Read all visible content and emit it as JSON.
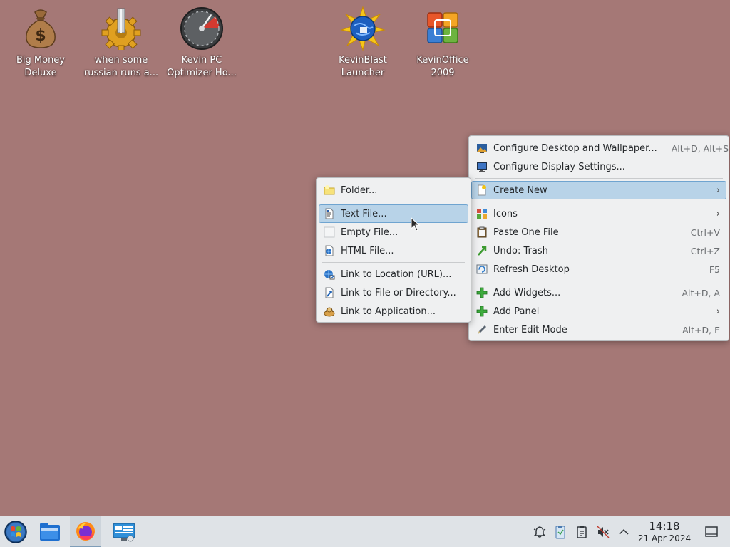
{
  "desktop": {
    "background_color": "#a57876",
    "icons": [
      {
        "line1": "Big Money",
        "line2": "Deluxe",
        "icon": "money-bag-icon"
      },
      {
        "line1": "when some",
        "line2": "russian runs a...",
        "icon": "gear-icon"
      },
      {
        "line1": "Kevin PC",
        "line2": "Optimizer Ho...",
        "icon": "gauge-icon"
      },
      {
        "line1": "KevinBlast",
        "line2": "Launcher",
        "icon": "globe-star-icon"
      },
      {
        "line1": "KevinOffice",
        "line2": "2009",
        "icon": "office-logo-icon"
      }
    ]
  },
  "context_menu": {
    "items": {
      "configure_desktop": {
        "label": "Configure Desktop and Wallpaper...",
        "shortcut": "Alt+D, Alt+S"
      },
      "configure_display": {
        "label": "Configure Display Settings..."
      },
      "create_new": {
        "label": "Create New",
        "highlighted": true
      },
      "icons": {
        "label": "Icons"
      },
      "paste": {
        "label": "Paste One File",
        "shortcut": "Ctrl+V"
      },
      "undo": {
        "label": "Undo: Trash",
        "shortcut": "Ctrl+Z"
      },
      "refresh": {
        "label": "Refresh Desktop",
        "shortcut": "F5"
      },
      "add_widgets": {
        "label": "Add Widgets...",
        "shortcut": "Alt+D, A"
      },
      "add_panel": {
        "label": "Add Panel"
      },
      "edit_mode": {
        "label": "Enter Edit Mode",
        "shortcut": "Alt+D, E"
      }
    }
  },
  "create_new_submenu": {
    "items": {
      "folder": {
        "label": "Folder..."
      },
      "text_file": {
        "label": "Text File...",
        "highlighted": true
      },
      "empty_file": {
        "label": "Empty File..."
      },
      "html_file": {
        "label": "HTML File..."
      },
      "link_url": {
        "label": "Link to Location (URL)..."
      },
      "link_file": {
        "label": "Link to File or Directory..."
      },
      "link_app": {
        "label": "Link to Application..."
      }
    }
  },
  "taskbar": {
    "clock": {
      "time": "14:18",
      "date": "21 Apr 2024"
    },
    "highlight_color": "#b8d3e8"
  }
}
